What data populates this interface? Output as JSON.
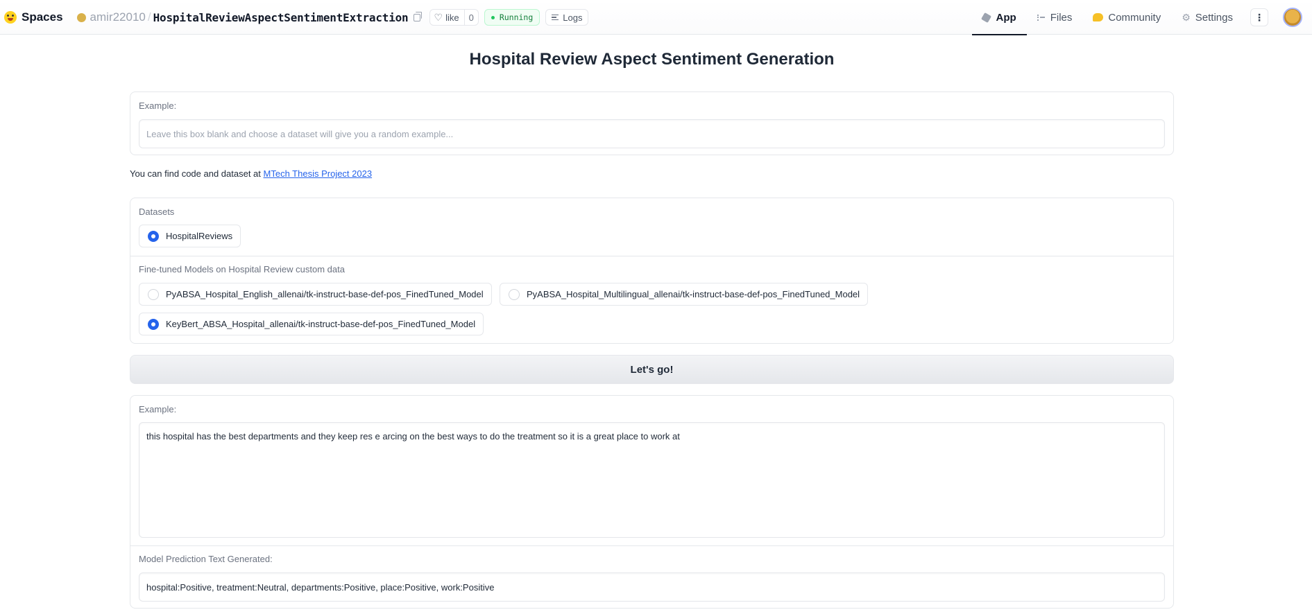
{
  "header": {
    "spaces_label": "Spaces",
    "owner": "amir22010",
    "separator": "/",
    "repo": "HospitalReviewAspectSentimentExtraction",
    "like_label": "like",
    "like_count": "0",
    "status": "Running",
    "logs_label": "Logs",
    "tabs": [
      {
        "label": "App",
        "icon": "app-cube-icon",
        "active": true
      },
      {
        "label": "Files",
        "icon": "files-icon",
        "active": false
      },
      {
        "label": "Community",
        "icon": "community-icon",
        "active": false
      },
      {
        "label": "Settings",
        "icon": "gear-icon",
        "active": false
      }
    ],
    "menu_glyph": "⋮"
  },
  "main": {
    "title": "Hospital Review Aspect Sentiment Generation",
    "example_input": {
      "label": "Example:",
      "placeholder": "Leave this box blank and choose a dataset will give you a random example...",
      "value": ""
    },
    "info": {
      "text": "You can find code and dataset at ",
      "link_text": "MTech Thesis Project 2023"
    },
    "datasets": {
      "label": "Datasets",
      "options": [
        {
          "label": "HospitalReviews",
          "checked": true
        }
      ]
    },
    "models": {
      "label": "Fine-tuned Models on Hospital Review custom data",
      "options": [
        {
          "label": "PyABSA_Hospital_English_allenai/tk-instruct-base-def-pos_FinedTuned_Model",
          "checked": false
        },
        {
          "label": "PyABSA_Hospital_Multilingual_allenai/tk-instruct-base-def-pos_FinedTuned_Model",
          "checked": false
        },
        {
          "label": "KeyBert_ABSA_Hospital_allenai/tk-instruct-base-def-pos_FinedTuned_Model",
          "checked": true
        }
      ]
    },
    "go_button": "Let's go!",
    "example_output": {
      "label": "Example:",
      "value": "this hospital has the best departments and they keep res e arcing on the best ways to do the treatment so it is a great place to work at"
    },
    "prediction": {
      "label": "Model Prediction Text Generated:",
      "value": "hospital:Positive, treatment:Neutral, departments:Positive, place:Positive, work:Positive"
    }
  },
  "colors": {
    "accent": "#2563eb",
    "running_bg": "#f0fdf4",
    "running_text": "#15803d"
  }
}
